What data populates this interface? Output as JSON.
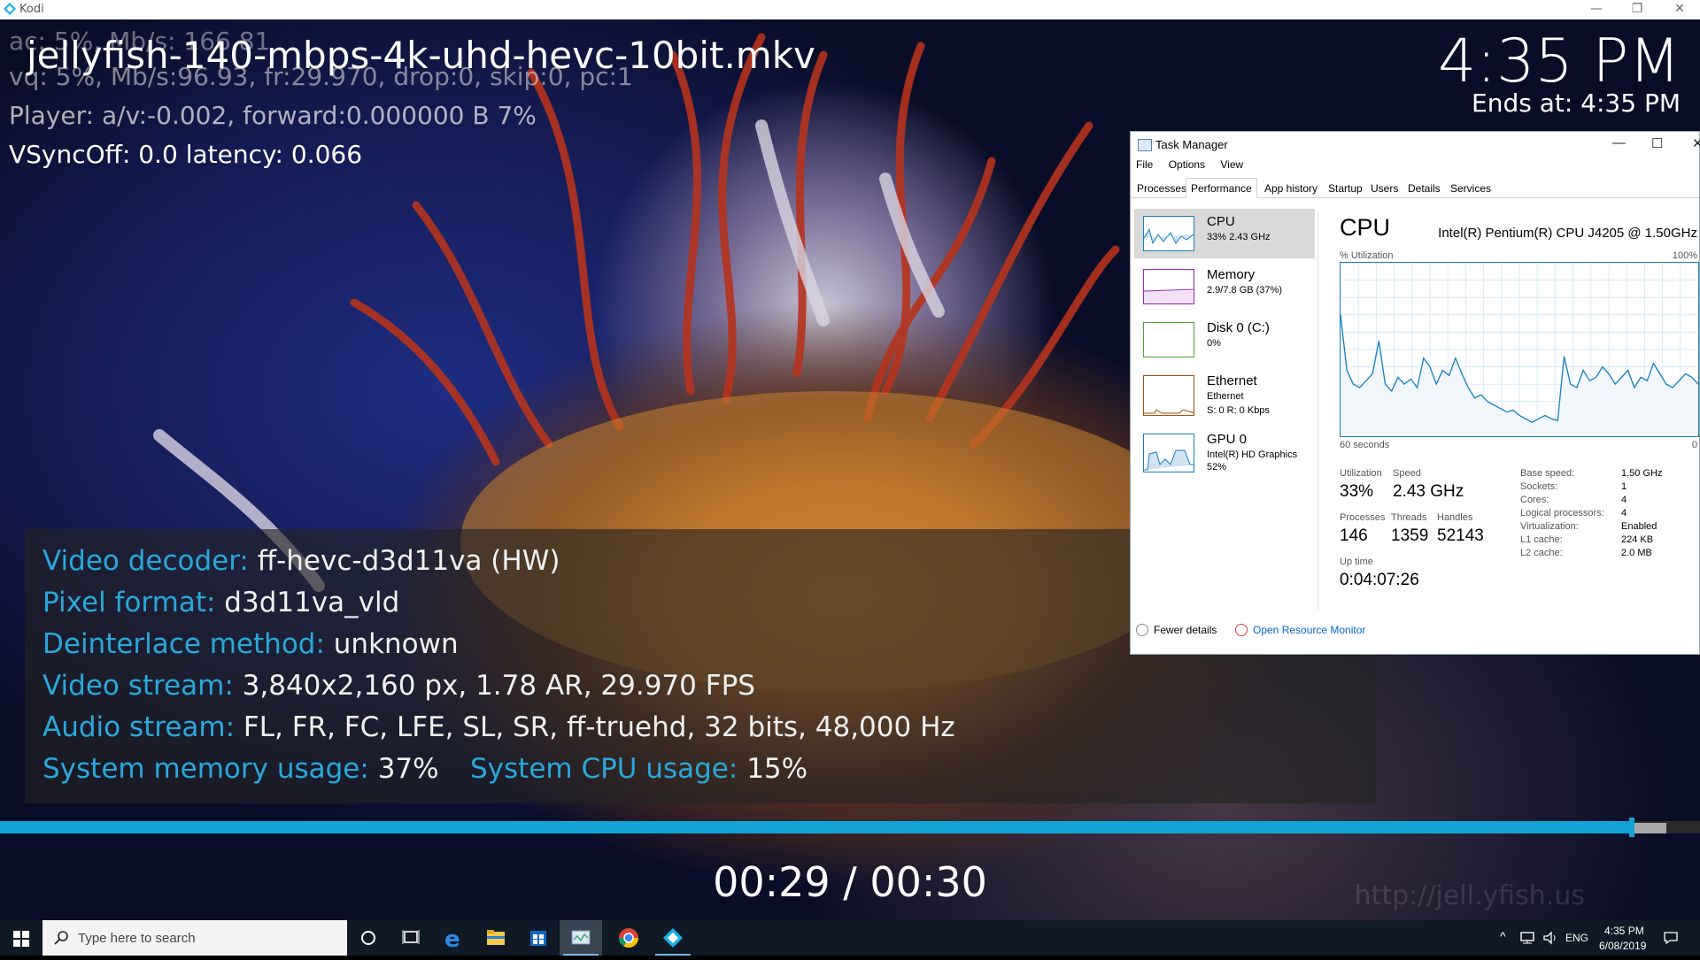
{
  "window": {
    "title": "Kodi",
    "minimize": "—",
    "restore": "❐",
    "close": "✕"
  },
  "osd": {
    "debug_line1": "ac: 5%, Mb/s: 166.81",
    "debug_line2": "vq: 5%, Mb/s:96.93, fr:29.970, drop:0, skip:0, pc:1",
    "debug_line3": "Player: a/v:-0.002,  forward:0.000000 B  7%",
    "debug_line4": "VSyncOff: 0.0 latency: 0.066",
    "file_title": "jellyfish-140-mbps-4k-uhd-hevc-10bit.mkv",
    "clock": "4:35 PM",
    "ends_at": "Ends at: 4:35 PM",
    "time_display": "00:29 / 00:30",
    "watermark": "http://jell.yfish.us",
    "progress": {
      "played_fraction": 0.96,
      "cache_end_fraction": 0.98
    }
  },
  "info": {
    "video_decoder_label": "Video decoder:",
    "video_decoder_value": "ff-hevc-d3d11va (HW)",
    "pixel_format_label": "Pixel format:",
    "pixel_format_value": "d3d11va_vld",
    "deinterlace_label": "Deinterlace method:",
    "deinterlace_value": "unknown",
    "video_stream_label": "Video stream:",
    "video_stream_value": "3,840x2,160 px, 1.78 AR, 29.970 FPS",
    "audio_stream_label": "Audio stream:",
    "audio_stream_value": "FL, FR, FC, LFE, SL, SR, ff-truehd, 32 bits, 48,000 Hz",
    "mem_label": "System memory usage:",
    "mem_value": "37%",
    "cpu_label": "System CPU usage:",
    "cpu_value": "15%"
  },
  "taskmanager": {
    "title": "Task Manager",
    "win_min": "—",
    "win_max": "☐",
    "win_close": "✕",
    "menu": [
      "File",
      "Options",
      "View"
    ],
    "tabs": [
      "Processes",
      "Performance",
      "App history",
      "Startup",
      "Users",
      "Details",
      "Services"
    ],
    "sidebar": [
      {
        "name": "CPU",
        "sub1": "33%  2.43 GHz",
        "sub2": "",
        "color": "#1180be"
      },
      {
        "name": "Memory",
        "sub1": "2.9/7.8 GB (37%)",
        "sub2": "",
        "color": "#9528b4"
      },
      {
        "name": "Disk 0 (C:)",
        "sub1": "0%",
        "sub2": "",
        "color": "#4ca832"
      },
      {
        "name": "Ethernet",
        "sub1": "Ethernet",
        "sub2": "S: 0 R: 0 Kbps",
        "color": "#a74f01"
      },
      {
        "name": "GPU 0",
        "sub1": "Intel(R) HD Graphics",
        "sub2": "52%",
        "color": "#1180be"
      }
    ],
    "detail": {
      "heading": "CPU",
      "model": "Intel(R) Pentium(R) CPU J4205 @ 1.50GHz",
      "util_label": "% Utilization",
      "util_max": "100%",
      "seconds_label": "60 seconds",
      "seconds_zero": "0",
      "utilization_label": "Utilization",
      "utilization_value": "33%",
      "speed_label": "Speed",
      "speed_value": "2.43 GHz",
      "processes_label": "Processes",
      "processes_value": "146",
      "threads_label": "Threads",
      "threads_value": "1359",
      "handles_label": "Handles",
      "handles_value": "52143",
      "uptime_label": "Up time",
      "uptime_value": "0:04:07:26",
      "specs": [
        {
          "k": "Base speed:",
          "v": "1.50 GHz"
        },
        {
          "k": "Sockets:",
          "v": "1"
        },
        {
          "k": "Cores:",
          "v": "4"
        },
        {
          "k": "Logical processors:",
          "v": "4"
        },
        {
          "k": "Virtualization:",
          "v": "Enabled"
        },
        {
          "k": "L1 cache:",
          "v": "224 KB"
        },
        {
          "k": "L2 cache:",
          "v": "2.0 MB"
        }
      ],
      "cpu_history": [
        70,
        38,
        30,
        28,
        32,
        36,
        55,
        30,
        26,
        34,
        30,
        33,
        28,
        45,
        40,
        30,
        38,
        35,
        45,
        36,
        28,
        22,
        24,
        20,
        18,
        16,
        14,
        15,
        12,
        10,
        8,
        10,
        12,
        10,
        9,
        46,
        30,
        28,
        38,
        32,
        34,
        40,
        36,
        30,
        34,
        38,
        28,
        34,
        32,
        42,
        36,
        30,
        28,
        32,
        36,
        34,
        30
      ]
    },
    "fewer_details": "Fewer details",
    "open_resource_monitor": "Open Resource Monitor"
  },
  "taskbar": {
    "search_placeholder": "Type here to search",
    "clock_time": "4:35 PM",
    "clock_date": "6/08/2019",
    "lang": "ENG"
  }
}
